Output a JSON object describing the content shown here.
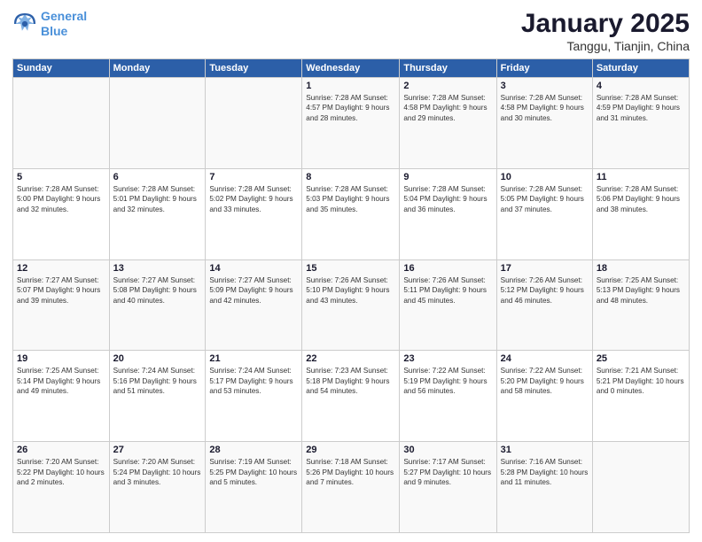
{
  "header": {
    "logo_line1": "General",
    "logo_line2": "Blue",
    "title": "January 2025",
    "subtitle": "Tanggu, Tianjin, China"
  },
  "weekdays": [
    "Sunday",
    "Monday",
    "Tuesday",
    "Wednesday",
    "Thursday",
    "Friday",
    "Saturday"
  ],
  "weeks": [
    [
      {
        "day": "",
        "detail": ""
      },
      {
        "day": "",
        "detail": ""
      },
      {
        "day": "",
        "detail": ""
      },
      {
        "day": "1",
        "detail": "Sunrise: 7:28 AM\nSunset: 4:57 PM\nDaylight: 9 hours\nand 28 minutes."
      },
      {
        "day": "2",
        "detail": "Sunrise: 7:28 AM\nSunset: 4:58 PM\nDaylight: 9 hours\nand 29 minutes."
      },
      {
        "day": "3",
        "detail": "Sunrise: 7:28 AM\nSunset: 4:58 PM\nDaylight: 9 hours\nand 30 minutes."
      },
      {
        "day": "4",
        "detail": "Sunrise: 7:28 AM\nSunset: 4:59 PM\nDaylight: 9 hours\nand 31 minutes."
      }
    ],
    [
      {
        "day": "5",
        "detail": "Sunrise: 7:28 AM\nSunset: 5:00 PM\nDaylight: 9 hours\nand 32 minutes."
      },
      {
        "day": "6",
        "detail": "Sunrise: 7:28 AM\nSunset: 5:01 PM\nDaylight: 9 hours\nand 32 minutes."
      },
      {
        "day": "7",
        "detail": "Sunrise: 7:28 AM\nSunset: 5:02 PM\nDaylight: 9 hours\nand 33 minutes."
      },
      {
        "day": "8",
        "detail": "Sunrise: 7:28 AM\nSunset: 5:03 PM\nDaylight: 9 hours\nand 35 minutes."
      },
      {
        "day": "9",
        "detail": "Sunrise: 7:28 AM\nSunset: 5:04 PM\nDaylight: 9 hours\nand 36 minutes."
      },
      {
        "day": "10",
        "detail": "Sunrise: 7:28 AM\nSunset: 5:05 PM\nDaylight: 9 hours\nand 37 minutes."
      },
      {
        "day": "11",
        "detail": "Sunrise: 7:28 AM\nSunset: 5:06 PM\nDaylight: 9 hours\nand 38 minutes."
      }
    ],
    [
      {
        "day": "12",
        "detail": "Sunrise: 7:27 AM\nSunset: 5:07 PM\nDaylight: 9 hours\nand 39 minutes."
      },
      {
        "day": "13",
        "detail": "Sunrise: 7:27 AM\nSunset: 5:08 PM\nDaylight: 9 hours\nand 40 minutes."
      },
      {
        "day": "14",
        "detail": "Sunrise: 7:27 AM\nSunset: 5:09 PM\nDaylight: 9 hours\nand 42 minutes."
      },
      {
        "day": "15",
        "detail": "Sunrise: 7:26 AM\nSunset: 5:10 PM\nDaylight: 9 hours\nand 43 minutes."
      },
      {
        "day": "16",
        "detail": "Sunrise: 7:26 AM\nSunset: 5:11 PM\nDaylight: 9 hours\nand 45 minutes."
      },
      {
        "day": "17",
        "detail": "Sunrise: 7:26 AM\nSunset: 5:12 PM\nDaylight: 9 hours\nand 46 minutes."
      },
      {
        "day": "18",
        "detail": "Sunrise: 7:25 AM\nSunset: 5:13 PM\nDaylight: 9 hours\nand 48 minutes."
      }
    ],
    [
      {
        "day": "19",
        "detail": "Sunrise: 7:25 AM\nSunset: 5:14 PM\nDaylight: 9 hours\nand 49 minutes."
      },
      {
        "day": "20",
        "detail": "Sunrise: 7:24 AM\nSunset: 5:16 PM\nDaylight: 9 hours\nand 51 minutes."
      },
      {
        "day": "21",
        "detail": "Sunrise: 7:24 AM\nSunset: 5:17 PM\nDaylight: 9 hours\nand 53 minutes."
      },
      {
        "day": "22",
        "detail": "Sunrise: 7:23 AM\nSunset: 5:18 PM\nDaylight: 9 hours\nand 54 minutes."
      },
      {
        "day": "23",
        "detail": "Sunrise: 7:22 AM\nSunset: 5:19 PM\nDaylight: 9 hours\nand 56 minutes."
      },
      {
        "day": "24",
        "detail": "Sunrise: 7:22 AM\nSunset: 5:20 PM\nDaylight: 9 hours\nand 58 minutes."
      },
      {
        "day": "25",
        "detail": "Sunrise: 7:21 AM\nSunset: 5:21 PM\nDaylight: 10 hours\nand 0 minutes."
      }
    ],
    [
      {
        "day": "26",
        "detail": "Sunrise: 7:20 AM\nSunset: 5:22 PM\nDaylight: 10 hours\nand 2 minutes."
      },
      {
        "day": "27",
        "detail": "Sunrise: 7:20 AM\nSunset: 5:24 PM\nDaylight: 10 hours\nand 3 minutes."
      },
      {
        "day": "28",
        "detail": "Sunrise: 7:19 AM\nSunset: 5:25 PM\nDaylight: 10 hours\nand 5 minutes."
      },
      {
        "day": "29",
        "detail": "Sunrise: 7:18 AM\nSunset: 5:26 PM\nDaylight: 10 hours\nand 7 minutes."
      },
      {
        "day": "30",
        "detail": "Sunrise: 7:17 AM\nSunset: 5:27 PM\nDaylight: 10 hours\nand 9 minutes."
      },
      {
        "day": "31",
        "detail": "Sunrise: 7:16 AM\nSunset: 5:28 PM\nDaylight: 10 hours\nand 11 minutes."
      },
      {
        "day": "",
        "detail": ""
      }
    ]
  ]
}
